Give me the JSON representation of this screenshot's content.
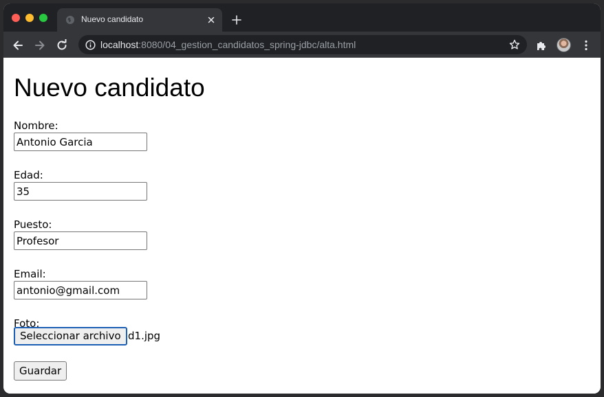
{
  "browser": {
    "tab": {
      "title": "Nuevo candidato",
      "favicon": "globe-icon"
    },
    "url": {
      "host": "localhost",
      "path": ":8080/04_gestion_candidatos_spring-jdbc/alta.html"
    },
    "icons": {
      "back": "arrow-left-icon",
      "forward": "arrow-right-icon",
      "reload": "reload-icon",
      "info": "info-icon",
      "bookmark": "star-icon",
      "extensions": "puzzle-icon",
      "profile": "avatar",
      "menu": "kebab-menu-icon"
    },
    "colors": {
      "tabstrip": "#202124",
      "active_tab": "#35363a",
      "omnibox": "#202124",
      "text": "#e8eaed",
      "muted_text": "#9aa0a6"
    }
  },
  "form": {
    "title": "Nuevo candidato",
    "fields": {
      "nombre": {
        "label": "Nombre:",
        "value": "Antonio Garcia"
      },
      "edad": {
        "label": "Edad:",
        "value": "35"
      },
      "puesto": {
        "label": "Puesto:",
        "value": "Profesor"
      },
      "email": {
        "label": "Email:",
        "value": "antonio@gmail.com"
      },
      "foto": {
        "label": "Foto:",
        "button_label": "Seleccionar archivo",
        "file_name": "d1.jpg"
      }
    },
    "submit_label": "Guardar",
    "colors": {
      "file_button_focus_border": "#1a5fb4",
      "button_background": "#efefef"
    }
  }
}
